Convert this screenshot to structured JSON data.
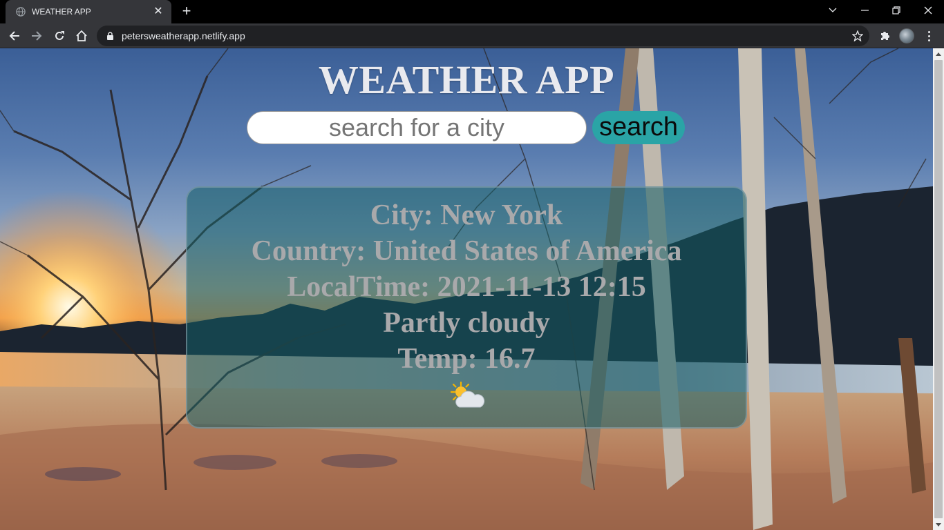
{
  "browser": {
    "tab_title": "WEATHER APP",
    "tab_close": "✕",
    "new_tab": "+",
    "url": "petersweatherapp.netlify.app"
  },
  "app": {
    "title": "WEATHER APP",
    "search": {
      "placeholder": "search for a city",
      "value": "",
      "button_label": "search"
    },
    "weather": {
      "city": "City: New York",
      "country": "Country: United States of America",
      "local_time": "LocalTime: 2021-11-13 12:15",
      "condition": "Partly cloudy",
      "temp": "Temp: 16.7",
      "icon": "partly-cloudy-icon"
    }
  },
  "colors": {
    "accent": "#2aa4a6",
    "card": "#125c66",
    "title": "#e9eaef",
    "card_text": "#a9a9ab"
  }
}
